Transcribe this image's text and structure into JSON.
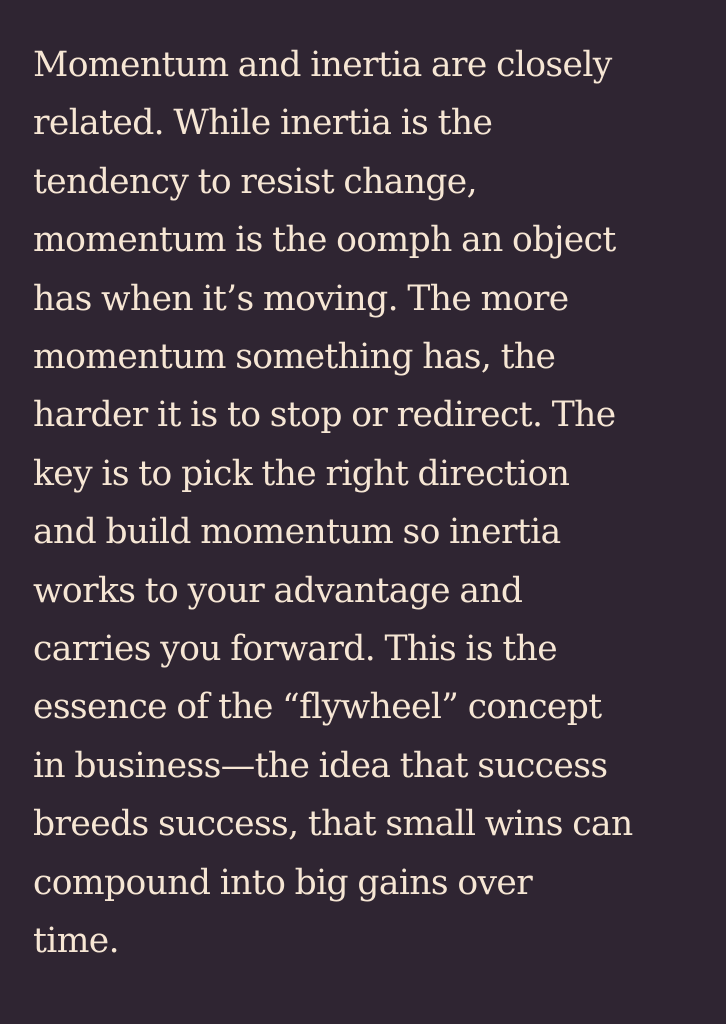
{
  "passage": {
    "lines": [
      "Momentum and inertia are closely",
      "related. While inertia is the",
      "tendency to resist change,",
      "momentum is the oomph an object",
      "has when it’s moving. The more",
      "momentum something has, the",
      "harder it is to stop or redirect. The",
      "key is to pick the right direction",
      "and build momentum so inertia",
      "works to your advantage and",
      "carries you forward. This is the",
      "essence of the “flywheel” concept",
      "in business—the idea that success",
      "breeds success, that small wins can",
      "compound into big gains over",
      "time."
    ]
  },
  "colors": {
    "background": "#2f2532",
    "text": "#f6e6d4"
  }
}
